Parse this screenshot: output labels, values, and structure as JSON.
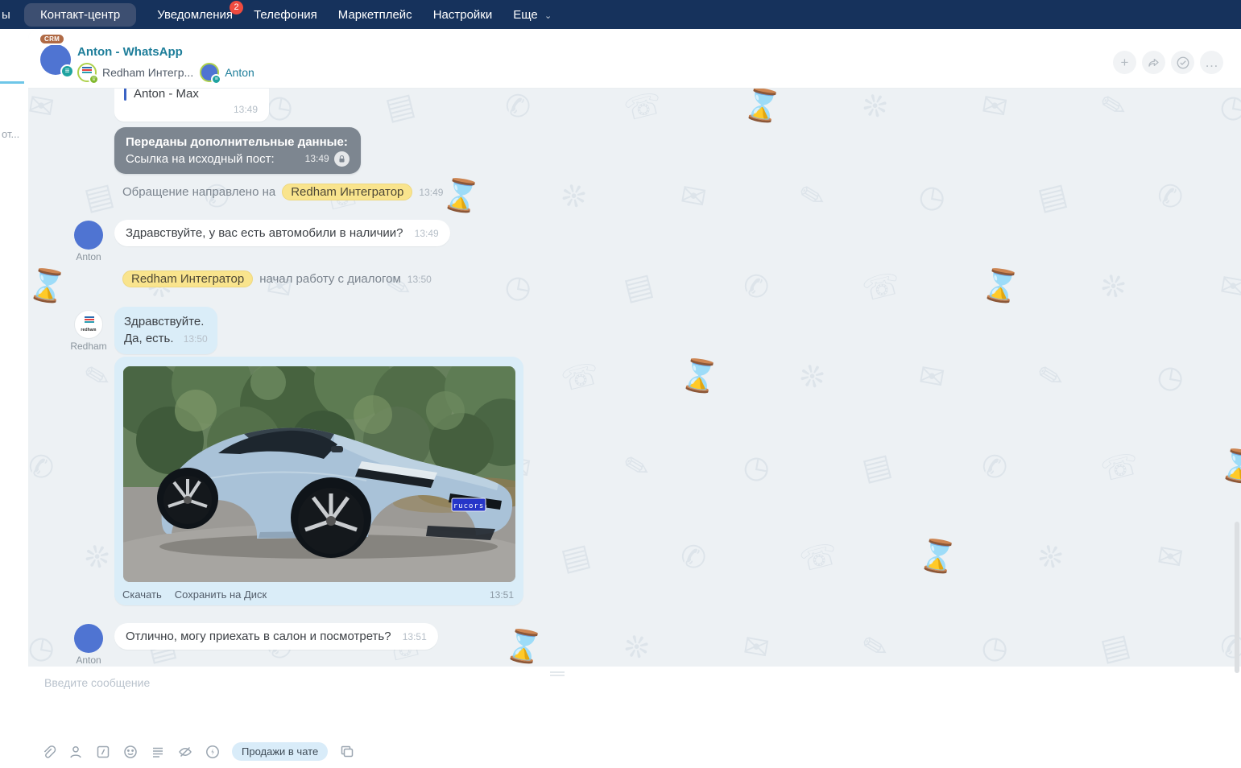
{
  "colors": {
    "nav_bg": "#16325c",
    "nav_active_bg": "#3d4f71",
    "badge_red": "#ef4b3f",
    "link_teal": "#1e7e9a",
    "avatar_blue": "#4f74d2",
    "channel_teal": "#1fa3a0",
    "bubble_gray": "#7d8690",
    "bubble_blue": "#daedf8",
    "pill_yellow": "#f9e48d",
    "chat_bg": "#edf1f4",
    "plate_blue": "#2636c8"
  },
  "nav": {
    "truncated_tab": "ы",
    "items": [
      {
        "label": "Контакт-центр"
      },
      {
        "label": "Уведомления",
        "badge": "2"
      },
      {
        "label": "Телефония"
      },
      {
        "label": "Маркетплейс"
      },
      {
        "label": "Настройки"
      },
      {
        "label": "Еще"
      }
    ],
    "more_chevron": "⌄"
  },
  "left_rail": {
    "truncated_text": "от..."
  },
  "header": {
    "title": "Anton - WhatsApp",
    "crm_badge": "CRM",
    "channel_icon_glyph": "≡",
    "assignee_name": "Redham Интегр...",
    "assignee_logo": "redham",
    "crown_glyph": "♕",
    "client_name": "Anton",
    "plus_glyph": "+",
    "more_glyph": "…"
  },
  "messages": {
    "m1": {
      "quote_title": "Anton - Max",
      "time": "13:49"
    },
    "m2": {
      "line1": "Переданы дополнительные данные:",
      "line2": "Ссылка на исходный пост:",
      "time": "13:49"
    },
    "m3": {
      "prefix": "Обращение направлено на",
      "pill": "Redham Интегратор",
      "time": "13:49"
    },
    "m4": {
      "author": "Anton",
      "text": "Здравствуйте, у вас есть автомобили в наличии?",
      "time": "13:49"
    },
    "m5": {
      "pill": "Redham Интегратор",
      "suffix": "начал работу с диалогом",
      "time": "13:50"
    },
    "m6": {
      "author": "Redham",
      "logo": "redham",
      "line1": "Здравствуйте.",
      "line2": "Да, есть.",
      "time": "13:50"
    },
    "m7": {
      "action_download": "Скачать",
      "action_save": "Сохранить на Диск",
      "time": "13:51",
      "plate": "rucors"
    },
    "m8": {
      "author": "Anton",
      "text": "Отлично, могу приехать в салон и посмотреть?",
      "time": "13:51"
    }
  },
  "composer": {
    "placeholder": "Введите сообщение",
    "sales_pill": "Продажи в чате"
  },
  "decor": {
    "pattern_glyphs": [
      "✉",
      "✎",
      "◷",
      "▤",
      "✆",
      "☏",
      "⌛",
      "❊"
    ]
  }
}
